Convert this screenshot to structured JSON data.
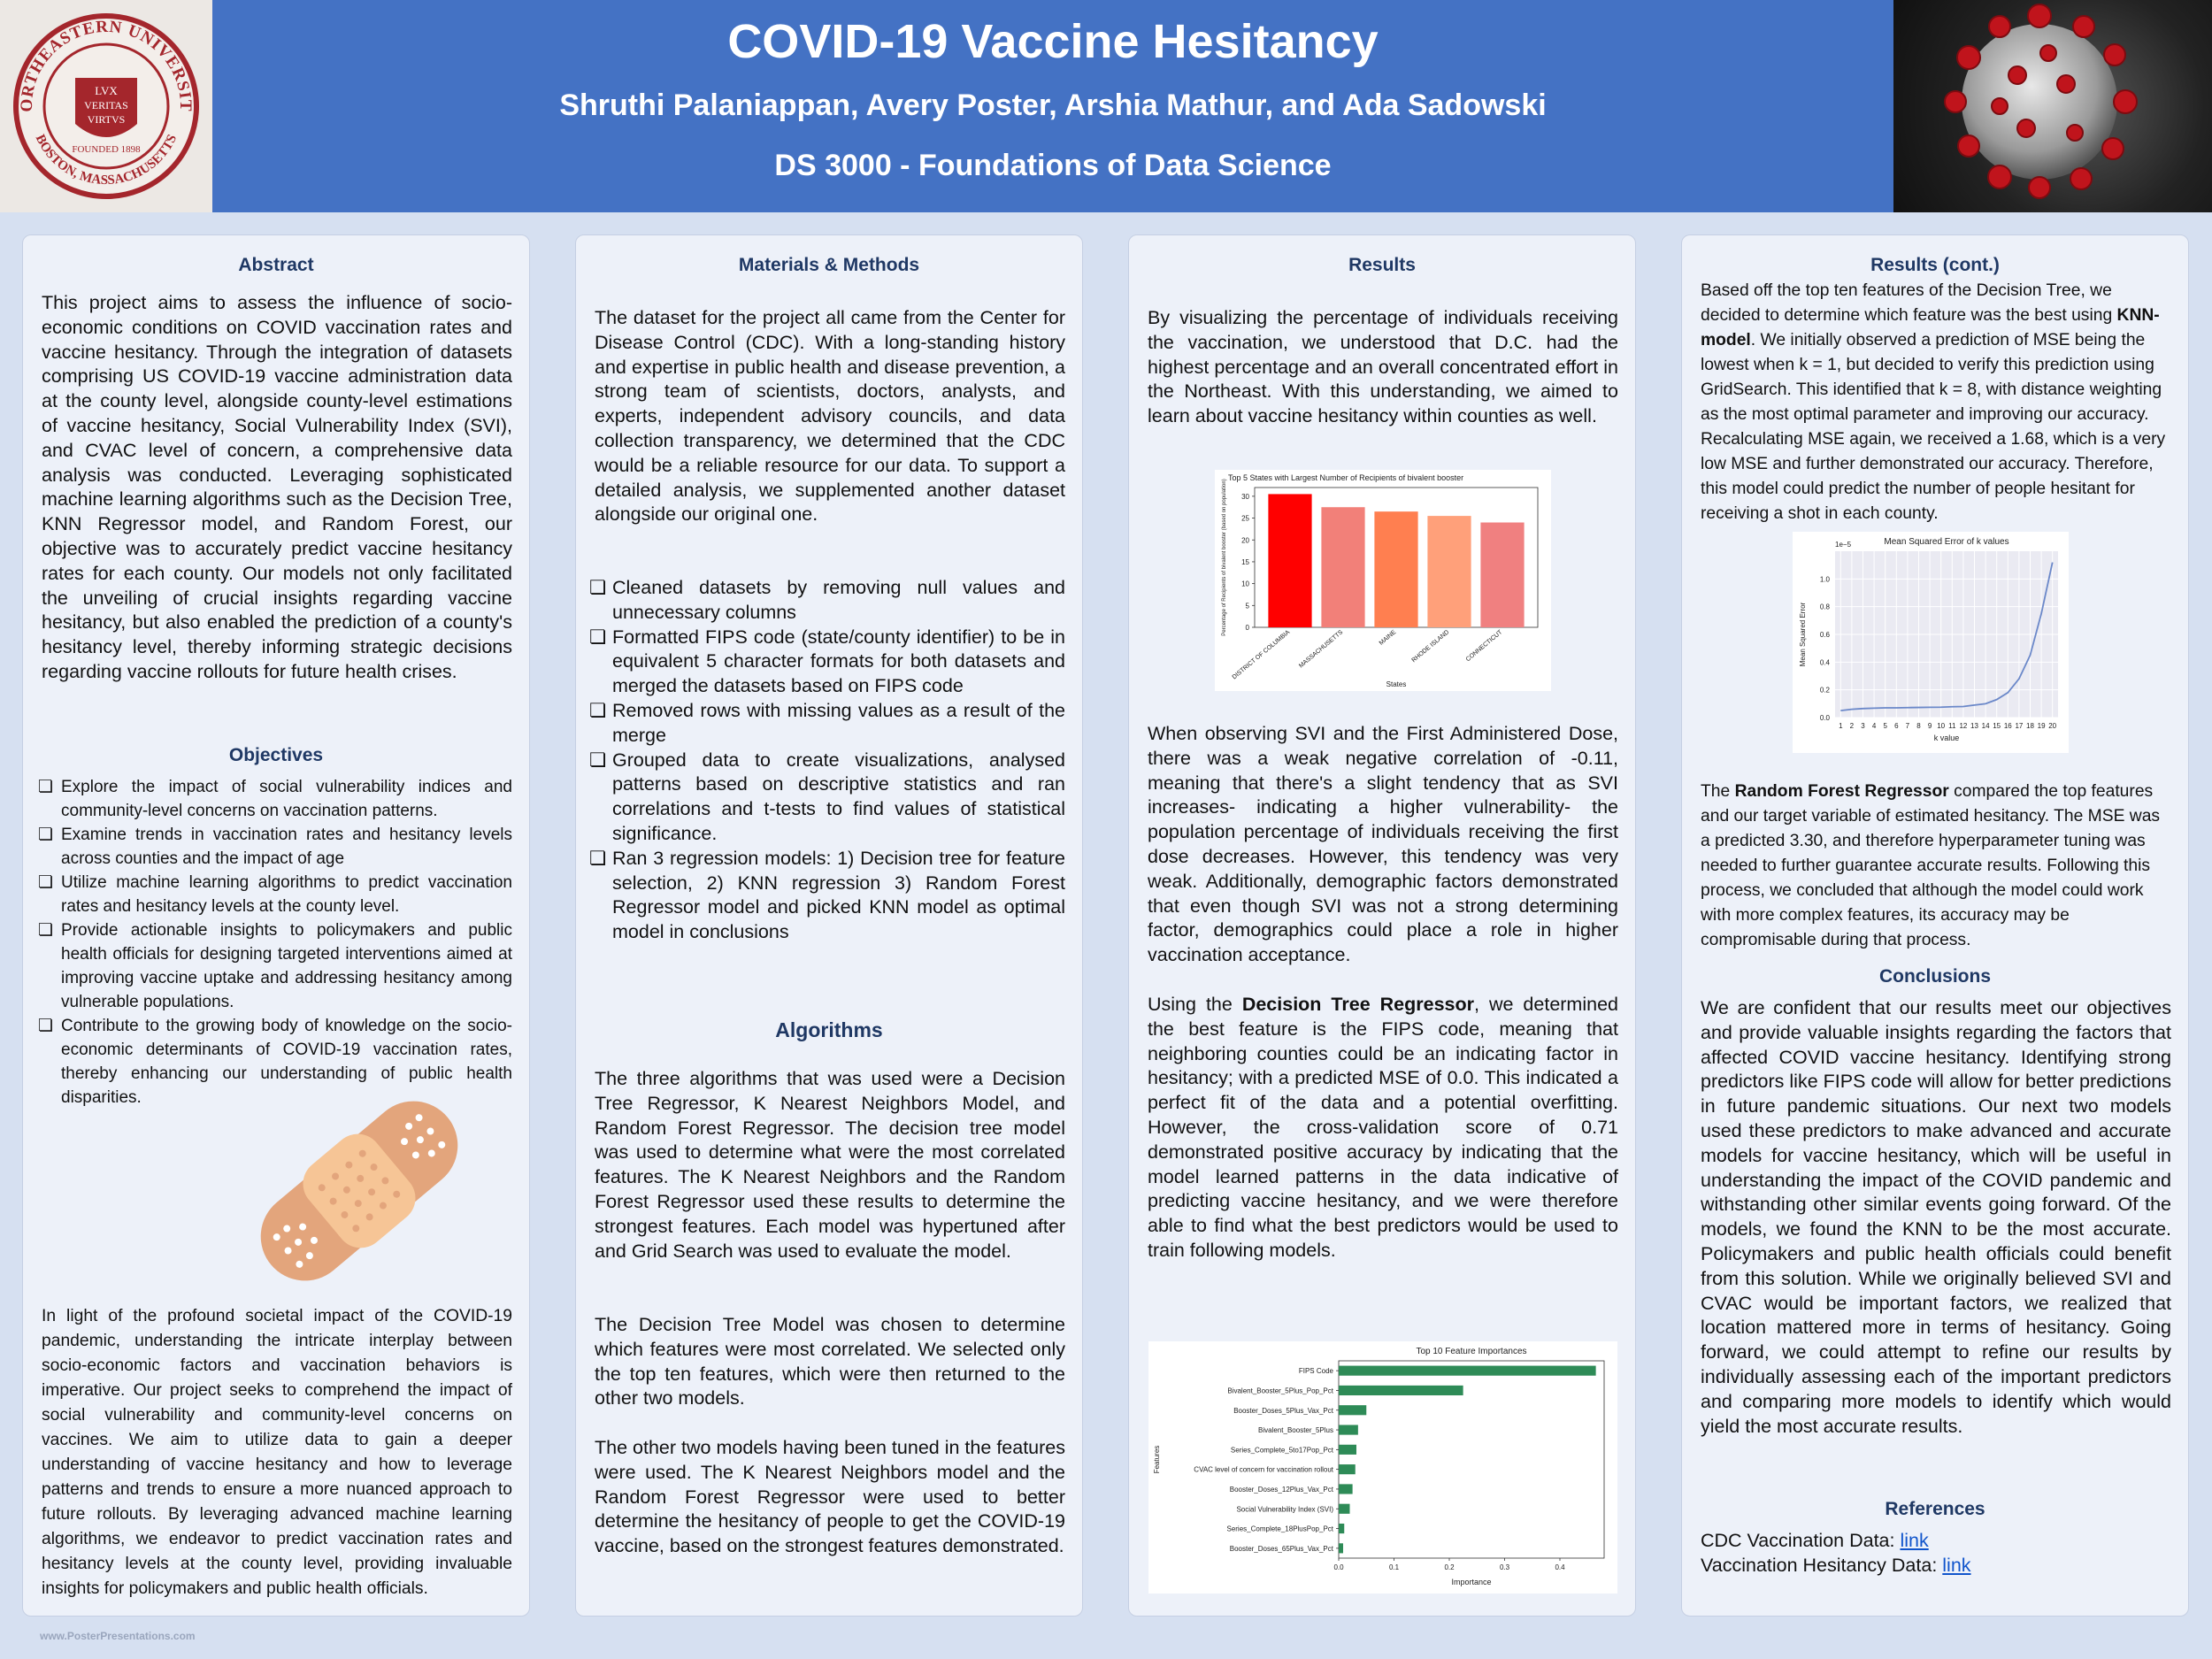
{
  "header": {
    "title": "COVID-19 Vaccine Hesitancy",
    "authors": "Shruthi Palaniappan, Avery Poster, Arshia Mathur, and Ada Sadowski",
    "course": "DS 3000 - Foundations of Data Science",
    "seal": {
      "ring_top": "NORTHEASTERN UNIVERSITY",
      "ring_bottom": "BOSTON, MASSACHUSETTS",
      "motto": [
        "LVX",
        "VERITAS",
        "VIRTVS"
      ],
      "founded": "FOUNDED 1898"
    },
    "colors": {
      "header_bg": "#4472c4",
      "page_bg": "#d6e0f1",
      "panel_bg": "#edf1f9",
      "heading": "#1f3864",
      "seal": "#a4262c"
    }
  },
  "abstract": {
    "heading": "Abstract",
    "text": "This project aims to assess the influence of socio-economic conditions on COVID vaccination rates and vaccine hesitancy. Through the integration of datasets comprising US COVID-19 vaccine administration data at the county level, alongside county-level estimations of vaccine hesitancy, Social Vulnerability Index (SVI), and CVAC level of concern, a comprehensive data analysis was conducted. Leveraging sophisticated machine learning algorithms such as the Decision Tree, KNN Regressor model, and Random Forest, our objective was to accurately predict vaccine hesitancy rates for each county. Our models not only facilitated the unveiling of crucial insights regarding vaccine hesitancy, but also enabled the prediction of a county's hesitancy level, thereby informing strategic decisions regarding vaccine rollouts for future health crises."
  },
  "objectives": {
    "heading": "Objectives",
    "bullet": "❏",
    "items": [
      "Explore the impact of social vulnerability indices and community-level concerns on vaccination patterns.",
      "Examine trends in vaccination rates and hesitancy levels across counties and the impact of age",
      "Utilize machine learning algorithms to predict vaccination rates and hesitancy levels at the county level.",
      "Provide actionable insights to policymakers and public health officials for designing targeted interventions aimed at improving vaccine uptake and addressing hesitancy among vulnerable populations.",
      "Contribute to the growing body of knowledge on the socio-economic determinants of COVID-19 vaccination rates, thereby enhancing our understanding of public health disparities."
    ],
    "closing": "In light of the profound societal impact of the COVID-19 pandemic, understanding the intricate interplay between socio-economic factors and vaccination behaviors is imperative. Our project seeks to comprehend the impact of social vulnerability and community-level concerns on vaccines. We aim to utilize data to gain a deeper understanding of vaccine hesitancy and how to leverage patterns and trends to ensure a more nuanced approach to future rollouts. By leveraging advanced machine learning algorithms, we endeavor to predict vaccination rates and hesitancy levels at the county level, providing invaluable insights for policymakers and public health officials."
  },
  "methods": {
    "heading": "Materials & Methods",
    "intro": "The dataset for the project all came from the Center for Disease Control (CDC). With a long-standing history and expertise in public health and disease prevention, a strong team of scientists, doctors, analysts, and experts, independent advisory councils, and data collection transparency, we determined that the CDC would be a reliable resource for our data. To support a detailed analysis, we supplemented another dataset alongside our original one.",
    "items": [
      "Cleaned datasets by removing null values and unnecessary columns",
      "Formatted FIPS code (state/county identifier) to be in equivalent 5 character formats for both datasets and merged the datasets based on FIPS code",
      "Removed  rows with missing values as a result of the merge",
      "Grouped  data to create visualizations, analysed patterns based on descriptive statistics and ran correlations and t-tests to find values of statistical significance.",
      "Ran 3  regression models: 1) Decision tree for feature selection, 2) KNN regression 3) Random Forest Regressor model and picked KNN model as optimal model in conclusions"
    ]
  },
  "algorithms": {
    "heading": "Algorithms",
    "p1": "The three algorithms that was used were a Decision Tree Regressor, K Nearest Neighbors Model, and Random Forest Regressor. The decision tree model was used to determine what were the most correlated features. The K Nearest Neighbors and the Random Forest Regressor used these results to determine the strongest features. Each model was hypertuned after and Grid Search was used to evaluate the model.",
    "p2": "The Decision Tree Model was chosen to determine which features were most correlated. We selected only the top ten features, which were then returned to the other two models.",
    "p3": "The other two models having been tuned in the features were used. The K Nearest Neighbors model and the Random Forest Regressor were used to better determine the hesitancy of people to get the COVID-19 vaccine, based on the strongest features demonstrated."
  },
  "results": {
    "heading": "Results",
    "p1": "By visualizing the percentage of individuals receiving the vaccination, we understood that D.C. had the highest percentage and an overall concentrated effort in the Northeast. With this understanding, we aimed to learn about vaccine hesitancy within counties as well.",
    "p2": "When observing SVI and the First Administered Dose, there was a weak negative correlation of -0.11, meaning that there's a slight tendency that as SVI increases- indicating a higher vulnerability- the population percentage of individuals receiving the first dose decreases. However, this tendency was very weak. Additionally, demographic factors demonstrated that even though SVI was not a strong determining factor, demographics could place a role in higher vaccination acceptance.",
    "p3_pre": "Using the ",
    "p3_bold": "Decision Tree Regressor",
    "p3_post": ", we determined the best feature is the FIPS code, meaning that neighboring counties could be an indicating factor in hesitancy; with a predicted MSE of 0.0. This indicated a perfect fit of the data and a potential overfitting. However, the cross-validation score of 0.71 demonstrated positive accuracy by indicating that the model learned patterns in the data indicative of predicting vaccine hesitancy, and we were therefore able to find what the best predictors would be used to train following models."
  },
  "results_cont": {
    "heading": "Results (cont.)",
    "p1_a": "Based off the top ten features of the Decision Tree, we decided to determine which feature was the best using ",
    "p1_bold": "KNN-model",
    "p1_b": ". We initially observed a prediction of MSE being the  lowest when k = 1,  but decided to verify this prediction using GridSearch. This identified that k = 8, with distance weighting as the most optimal parameter and improving our accuracy. Recalculating MSE again, we received a 1.68, which is a very low MSE and further demonstrated our accuracy. Therefore, this model could predict the number of people hesitant for receiving a shot in each county.",
    "p2_a": "The ",
    "p2_bold": "Random Forest Regressor",
    "p2_b": " compared the top features and our target variable of estimated hesitancy.  The MSE was a predicted 3.30, and therefore hyperparameter tuning was needed to further guarantee accurate results. Following this process, we concluded that although the model could work with more complex features, its accuracy may be compromisable during that process."
  },
  "conclusions": {
    "heading": "Conclusions",
    "text": "We are confident that our results meet our objectives and provide valuable insights regarding the factors that affected COVID vaccine hesitancy. Identifying strong predictors like FIPS code will allow for better predictions in future pandemic situations. Our next two models used these predictors to make advanced and accurate models for vaccine hesitancy, which will be useful in understanding the impact of the COVID pandemic and withstanding other similar events going forward. Of the models, we found the KNN to be the most accurate. Policymakers and public health officials could benefit from this solution. While we originally believed SVI and CVAC would be important factors, we realized that location mattered more in terms of hesitancy. Going forward, we could attempt to refine our results by individually assessing each of the important predictors and comparing more models to identify which would yield the most accurate results."
  },
  "references": {
    "heading": "References",
    "items": [
      {
        "label": "CDC Vaccination Data: ",
        "link": "link"
      },
      {
        "label": "Vaccination Hesitancy Data: ",
        "link": "link"
      }
    ]
  },
  "footer": {
    "text": "www.PosterPresentations.com"
  },
  "icons": {
    "bandage": "bandage-icon",
    "virus": "coronavirus-image",
    "seal": "university-seal"
  },
  "chart_data": [
    {
      "type": "bar",
      "title": "Top 5 States with Largest Number of Recipients of bivalent booster",
      "xlabel": "States",
      "ylabel": "Percentage of Recipients of bivalent booster (based on population)",
      "categories": [
        "DISTRICT OF COLUMBIA",
        "MASSACHUSETTS",
        "MAINE",
        "RHODE ISLAND",
        "CONNECTICUT"
      ],
      "values": [
        30.5,
        27.5,
        26.5,
        25.5,
        24.0
      ],
      "colors": [
        "#ff0000",
        "#f28079",
        "#ff7f50",
        "#ffa07a",
        "#f08080"
      ],
      "ylim": [
        0,
        32
      ],
      "yticks": [
        0,
        5,
        10,
        15,
        20,
        25,
        30
      ]
    },
    {
      "type": "line",
      "title": "Mean Squared Error of k values",
      "xlabel": "k value",
      "ylabel": "Mean Squared Error",
      "yscale_label": "1e−5",
      "x": [
        1,
        2,
        3,
        4,
        5,
        6,
        7,
        8,
        9,
        10,
        11,
        12,
        13,
        14,
        15,
        16,
        17,
        18,
        19,
        20
      ],
      "y": [
        0.05,
        0.06,
        0.065,
        0.068,
        0.07,
        0.07,
        0.072,
        0.073,
        0.074,
        0.075,
        0.078,
        0.08,
        0.09,
        0.1,
        0.13,
        0.18,
        0.28,
        0.45,
        0.75,
        1.12
      ],
      "ylim": [
        0,
        1.2
      ],
      "yticks": [
        0.0,
        0.2,
        0.4,
        0.6,
        0.8,
        1.0
      ],
      "grid": true,
      "color": "#6b88c9"
    },
    {
      "type": "bar",
      "orientation": "horizontal",
      "title": "Top 10 Feature Importances",
      "xlabel": "Importance",
      "ylabel": "Features",
      "categories": [
        "FIPS Code",
        "Bivalent_Booster_5Plus_Pop_Pct",
        "Booster_Doses_5Plus_Vax_Pct",
        "Bivalent_Booster_5Plus",
        "Series_Complete_5to17Pop_Pct",
        "CVAC level of concern for vaccination rollout",
        "Booster_Doses_12Plus_Vax_Pct",
        "Social Vulnerability Index (SVI)",
        "Series_Complete_18PlusPop_Pct",
        "Booster_Doses_65Plus_Vax_Pct"
      ],
      "values": [
        0.465,
        0.225,
        0.05,
        0.035,
        0.032,
        0.03,
        0.025,
        0.02,
        0.01,
        0.008
      ],
      "xlim": [
        0,
        0.48
      ],
      "xticks": [
        0.0,
        0.1,
        0.2,
        0.3,
        0.4
      ],
      "color": "#2e8b57"
    }
  ]
}
